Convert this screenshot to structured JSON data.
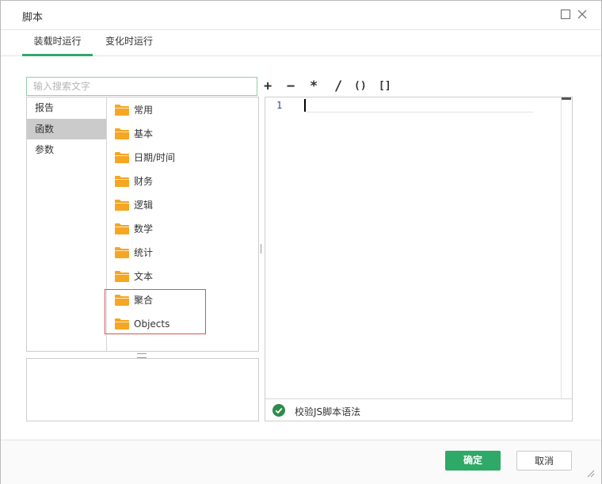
{
  "window": {
    "title": "脚本"
  },
  "tabs": [
    {
      "label": "装载时运行",
      "active": true
    },
    {
      "label": "变化时运行",
      "active": false
    }
  ],
  "search": {
    "placeholder": "输入搜索文字",
    "value": ""
  },
  "categories": [
    {
      "label": "报告",
      "selected": false
    },
    {
      "label": "函数",
      "selected": true
    },
    {
      "label": "参数",
      "selected": false
    }
  ],
  "functions": [
    "常用",
    "基本",
    "日期/时间",
    "财务",
    "逻辑",
    "数学",
    "统计",
    "文本",
    "聚合",
    "Objects"
  ],
  "operators": [
    "+",
    "−",
    "*",
    "/",
    "()",
    "[]"
  ],
  "editor": {
    "line_number": "1",
    "content": ""
  },
  "validate": {
    "label": "校验JS脚本语法"
  },
  "footer": {
    "ok_label": "确定",
    "cancel_label": "取消"
  },
  "colors": {
    "accent": "#2ea967",
    "folder": "#f5a623",
    "highlight_border": "#d9534f"
  }
}
